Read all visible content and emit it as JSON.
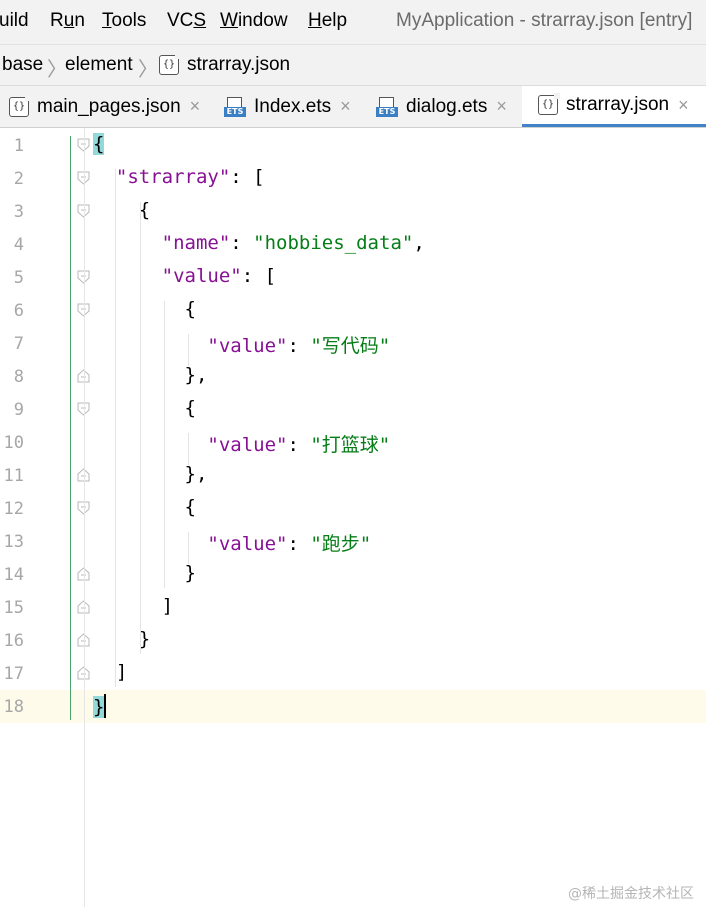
{
  "menubar": {
    "items": [
      {
        "prefix": "",
        "underline": "",
        "suffix": "uild"
      },
      {
        "prefix": "R",
        "underline": "u",
        "suffix": "n"
      },
      {
        "prefix": "",
        "underline": "T",
        "suffix": "ools"
      },
      {
        "prefix": "VC",
        "underline": "S",
        "suffix": ""
      },
      {
        "prefix": "",
        "underline": "W",
        "suffix": "indow"
      },
      {
        "prefix": "",
        "underline": "H",
        "suffix": "elp"
      }
    ],
    "window_title": "MyApplication - strarray.json [entry]"
  },
  "breadcrumb": {
    "items": [
      "base",
      "element",
      "strarray.json"
    ],
    "file_icon": "json-file-icon"
  },
  "tabs": [
    {
      "label": "main_pages.json",
      "icon": "json-file-icon",
      "active": false
    },
    {
      "label": "Index.ets",
      "icon": "ets-file-icon",
      "active": false
    },
    {
      "label": "dialog.ets",
      "icon": "ets-file-icon",
      "active": false
    },
    {
      "label": "strarray.json",
      "icon": "json-file-icon",
      "active": true
    }
  ],
  "tab_close_glyph": "×",
  "editor": {
    "current_line": 18,
    "lines": [
      {
        "num": "1",
        "tokens": [
          {
            "t": "{",
            "c": "brace-hl"
          }
        ],
        "fold": "open"
      },
      {
        "num": "2",
        "tokens": [
          {
            "t": "  "
          },
          {
            "t": "\"strarray\"",
            "c": "k"
          },
          {
            "t": ": ["
          }
        ],
        "fold": "open"
      },
      {
        "num": "3",
        "tokens": [
          {
            "t": "    {"
          }
        ],
        "fold": "open"
      },
      {
        "num": "4",
        "tokens": [
          {
            "t": "      "
          },
          {
            "t": "\"name\"",
            "c": "k"
          },
          {
            "t": ": "
          },
          {
            "t": "\"hobbies_data\"",
            "c": "s"
          },
          {
            "t": ","
          }
        ],
        "fold": ""
      },
      {
        "num": "5",
        "tokens": [
          {
            "t": "      "
          },
          {
            "t": "\"value\"",
            "c": "k"
          },
          {
            "t": ": ["
          }
        ],
        "fold": "open"
      },
      {
        "num": "6",
        "tokens": [
          {
            "t": "        {"
          }
        ],
        "fold": "open"
      },
      {
        "num": "7",
        "tokens": [
          {
            "t": "          "
          },
          {
            "t": "\"value\"",
            "c": "k"
          },
          {
            "t": ": "
          },
          {
            "t": "\"写代码\"",
            "c": "s"
          }
        ],
        "fold": ""
      },
      {
        "num": "8",
        "tokens": [
          {
            "t": "        },"
          }
        ],
        "fold": "close"
      },
      {
        "num": "9",
        "tokens": [
          {
            "t": "        {"
          }
        ],
        "fold": "open"
      },
      {
        "num": "10",
        "tokens": [
          {
            "t": "          "
          },
          {
            "t": "\"value\"",
            "c": "k"
          },
          {
            "t": ": "
          },
          {
            "t": "\"打篮球\"",
            "c": "s"
          }
        ],
        "fold": ""
      },
      {
        "num": "11",
        "tokens": [
          {
            "t": "        },"
          }
        ],
        "fold": "close"
      },
      {
        "num": "12",
        "tokens": [
          {
            "t": "        {"
          }
        ],
        "fold": "open"
      },
      {
        "num": "13",
        "tokens": [
          {
            "t": "          "
          },
          {
            "t": "\"value\"",
            "c": "k"
          },
          {
            "t": ": "
          },
          {
            "t": "\"跑步\"",
            "c": "s"
          }
        ],
        "fold": ""
      },
      {
        "num": "14",
        "tokens": [
          {
            "t": "        }"
          }
        ],
        "fold": "close"
      },
      {
        "num": "15",
        "tokens": [
          {
            "t": "      ]"
          }
        ],
        "fold": "close"
      },
      {
        "num": "16",
        "tokens": [
          {
            "t": "    }"
          }
        ],
        "fold": "close"
      },
      {
        "num": "17",
        "tokens": [
          {
            "t": "  ]"
          }
        ],
        "fold": "close"
      },
      {
        "num": "18",
        "tokens": [
          {
            "t": "}",
            "c": "brace-hl"
          },
          {
            "caret": true
          }
        ],
        "fold": ""
      }
    ]
  },
  "colors": {
    "keyword": "#871094",
    "string": "#067d17",
    "brace_match": "#93d9d9",
    "active_tab_underline": "#4083c9",
    "current_line": "#fefbeb"
  },
  "watermark": "@稀土掘金技术社区"
}
